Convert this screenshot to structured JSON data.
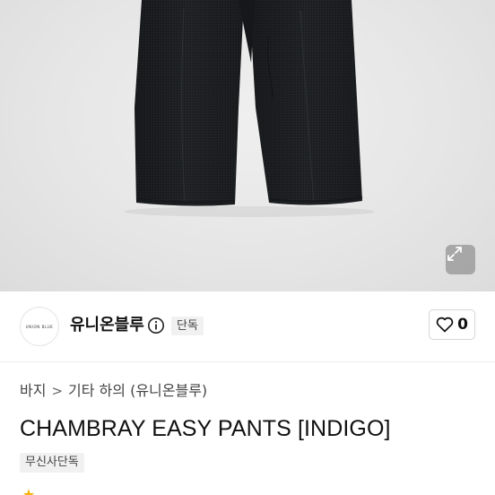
{
  "product_image": {
    "alt": "pants-image",
    "icon": "expand-icon"
  },
  "brand": {
    "logo_text": "UNION BLUE",
    "name": "유니온블루",
    "info_icon": "info-icon",
    "badge": "단독"
  },
  "like": {
    "icon": "heart-icon",
    "count": "0"
  },
  "breadcrumb": {
    "items": [
      "바지",
      "기타 하의 (유니온블루)"
    ],
    "separator": ">"
  },
  "product": {
    "title": "CHAMBRAY EASY PANTS [INDIGO]",
    "tag": "무신사단독"
  },
  "colors": {
    "pants": "#1f2124",
    "hero_bg": "#e6e6e6",
    "badge_bg": "#f1f1f1",
    "star": "#f5b400"
  }
}
